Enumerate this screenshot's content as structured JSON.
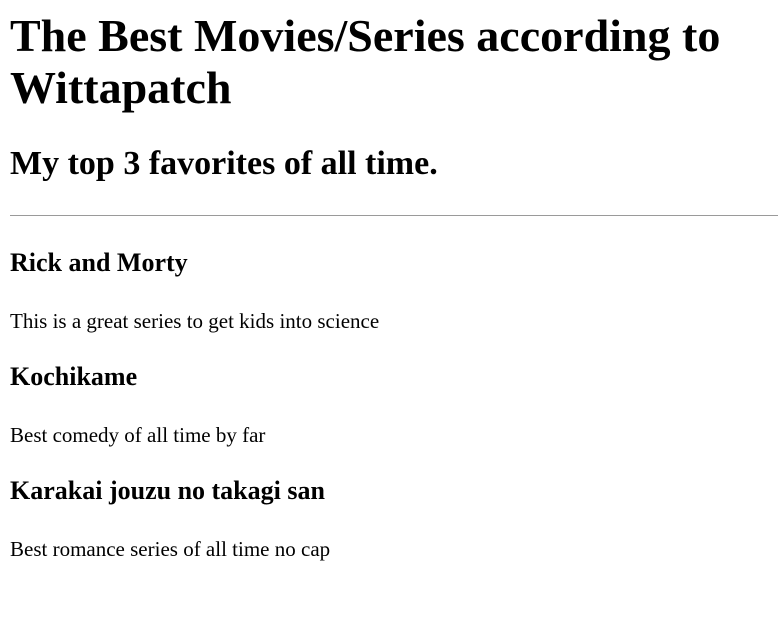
{
  "page": {
    "title": "The Best Movies/Series according to Wittapatch",
    "subtitle": "My top 3 favorites of all time."
  },
  "favorites": [
    {
      "title": "Rick and Morty",
      "description": "This is a great series to get kids into science"
    },
    {
      "title": "Kochikame",
      "description": "Best comedy of all time by far"
    },
    {
      "title": "Karakai jouzu no takagi san",
      "description": "Best romance series of all time no cap"
    }
  ]
}
